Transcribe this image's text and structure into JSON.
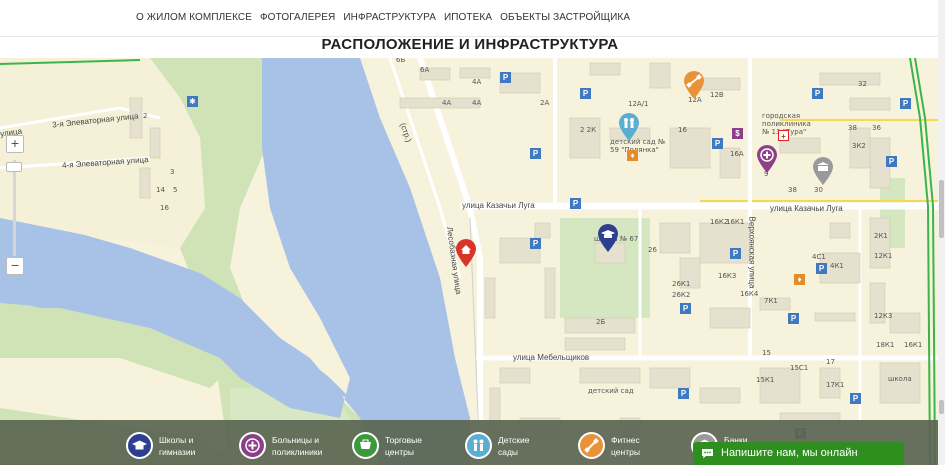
{
  "nav": {
    "items": [
      "О ЖИЛОМ КОМПЛЕКСЕ",
      "ФОТОГАЛЕРЕЯ",
      "ИНФРАСТРУКТУРА",
      "ИПОТЕКА",
      "ОБЪЕКТЫ ЗАСТРОЙЩИКА"
    ]
  },
  "section": {
    "title": "РАСПОЛОЖЕНИЕ И ИНФРАСТРУКТУРА"
  },
  "map": {
    "zoom_in": "+",
    "zoom_out": "−",
    "streets": {
      "elevatornaya3": "3-я Элеваторная улица",
      "elevatornaya4": "4-я Элеваторная улица",
      "kazachi_lug_1": "улица Казачьи Луга",
      "kazachi_lug_2": "улица Казачьи Луга",
      "mebelshchikov": "улица Мебельщиков",
      "lesobaznaya": "Лесобазная улица",
      "verkhoyanskaya": "Верхоянская улица",
      "ulitsa_left": "улица",
      "str": "(стр.)"
    },
    "places": {
      "kindergarten59": "детский сад №\n59 \"Полянка\"",
      "polyclinic13": "городская\nполиклиника\n№ 13 \"Тура\"",
      "school67": "школа № 67",
      "kindergarten_bottom": "детский сад",
      "school_right": "школа"
    },
    "house_numbers": {
      "n6b": "6Б",
      "n6a": "6А",
      "n4a1": "4А",
      "n4a2": "4А",
      "n4a3": "4А",
      "n2a": "2А",
      "n12a1": "12А/1",
      "n12a": "12А",
      "n12v": "12В",
      "n32": "32",
      "n2k": "2 2К",
      "n16": "16",
      "n38": "38",
      "n36": "36",
      "n3k2": "3К2",
      "n16a": "16А",
      "n9": "9",
      "n38b": "38",
      "n30": "30",
      "n16k2": "16К2",
      "n16k1": "16К1",
      "n4c1": "4С1",
      "n4k1": "4К1",
      "n12k1": "12К1",
      "n2k1": "2К1",
      "n26": "26",
      "n26k1": "26К1",
      "n26k2": "26К2",
      "n16k3": "16К3",
      "n16k4": "16К4",
      "n7k1": "7К1",
      "n2b": "2Б",
      "n12k3": "12К3",
      "n18k1": "18К1",
      "n16k1b": "16К1",
      "n15": "15",
      "n15c1": "15С1",
      "n15k1": "15К1",
      "n17k1": "17К1",
      "n17": "17",
      "n2": "2",
      "n3": "3",
      "n14": "14",
      "n5": "5",
      "n16l": "16"
    }
  },
  "legend": {
    "items": [
      {
        "line1": "Школы и",
        "line2": "гимназии",
        "color": "#2f3f8f"
      },
      {
        "line1": "Больницы и",
        "line2": "поликлиники",
        "color": "#8d3f8a"
      },
      {
        "line1": "Торговые",
        "line2": "центры",
        "color": "#3c9a3c"
      },
      {
        "line1": "Детские",
        "line2": "сады",
        "color": "#5aaed2"
      },
      {
        "line1": "Фитнес",
        "line2": "центры",
        "color": "#e8923a"
      },
      {
        "line1": "Банки",
        "line2": "",
        "color": "#9a9a9a"
      }
    ]
  },
  "chat": {
    "label": "Напишите нам, мы онлайн"
  },
  "colors": {
    "river": "#a7c2e6",
    "park": "#cfe3b6",
    "road_yellow": "#f5d94e",
    "road_green": "#3bb54a",
    "home_marker": "#d9342b"
  },
  "icons": {
    "home": "home-icon",
    "school": "graduation-cap-icon",
    "hospital": "plus-cross-icon",
    "shop": "shopping-bag-icon",
    "kids": "children-icon",
    "fitness": "dumbbell-icon",
    "bank": "bank-icon",
    "chat": "chat-bubble-icon"
  }
}
